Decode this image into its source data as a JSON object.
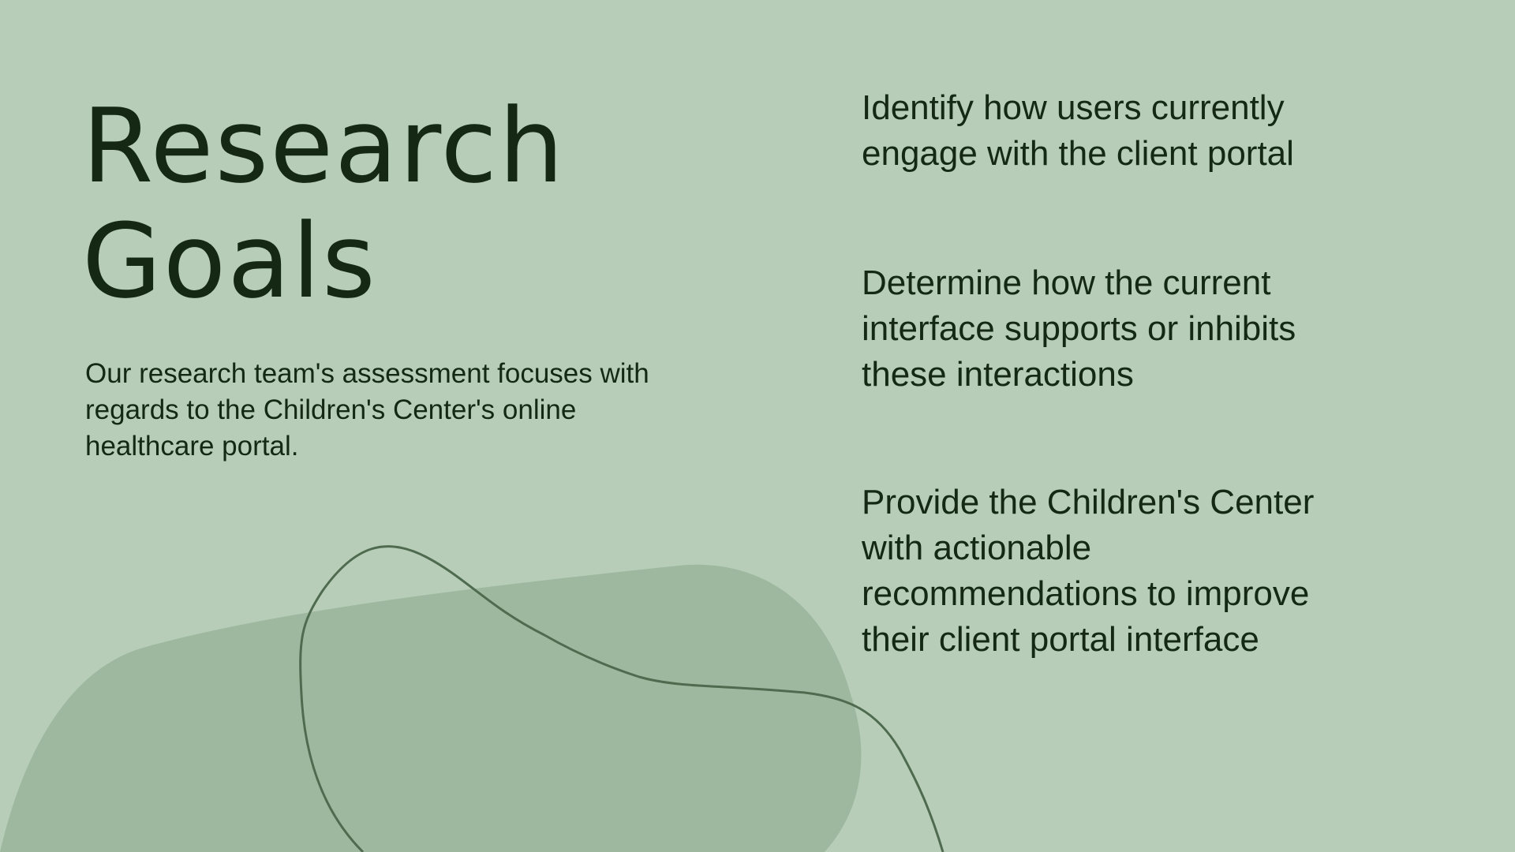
{
  "slide": {
    "title_line1": "Research",
    "title_line2": "Goals",
    "intro": "Our research team's assessment focuses with regards to the Children's Center's online healthcare portal.",
    "goals": [
      "Identify how users currently engage with the client portal",
      "Determine how the current interface supports or inhibits these interactions",
      "Provide the Children's Center with actionable recommendations to improve their client portal interface"
    ]
  },
  "colors": {
    "background": "#b7cdb8",
    "blob": "#9eb89f",
    "line": "#4f6b4f",
    "text": "#142814"
  }
}
